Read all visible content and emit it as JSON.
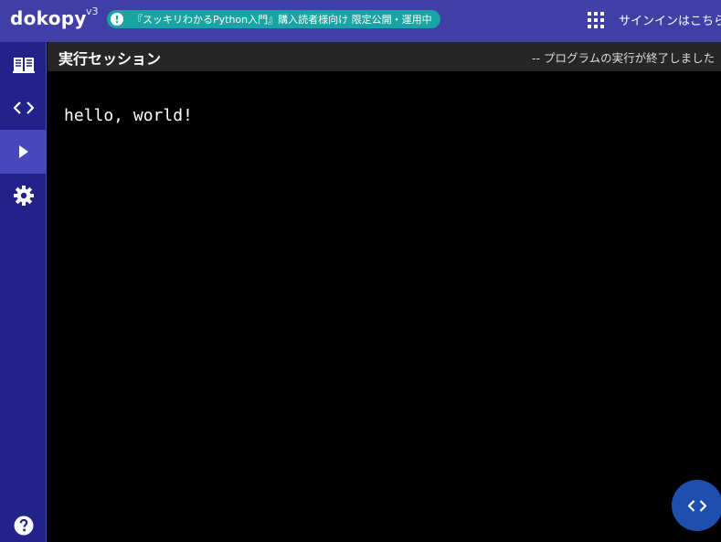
{
  "header": {
    "logo": "dokopy",
    "version": "v3",
    "notice_icon": "!",
    "notice": "『スッキリわかるPython入門』購入読者様向け 限定公開・運用中",
    "apps_icon": "apps-grid-icon",
    "signin_label": "サインインはこちら"
  },
  "sidebar": {
    "items": [
      {
        "icon": "book-icon",
        "active": false
      },
      {
        "icon": "code-icon",
        "active": false
      },
      {
        "icon": "play-icon",
        "active": true
      },
      {
        "icon": "gear-icon",
        "active": false
      }
    ],
    "help_icon": "help-icon"
  },
  "session": {
    "title": "実行セッション",
    "status": "-- プログラムの実行が終了しました"
  },
  "console": {
    "output": "hello, world!"
  },
  "fab": {
    "icon": "code-icon"
  },
  "colors": {
    "header": "#3f3fa6",
    "sidebar": "#22228a",
    "sidebar_active": "#4848bb",
    "notice": "#1aa3a3",
    "session_bar": "#262626",
    "fab": "#1e4fae"
  }
}
